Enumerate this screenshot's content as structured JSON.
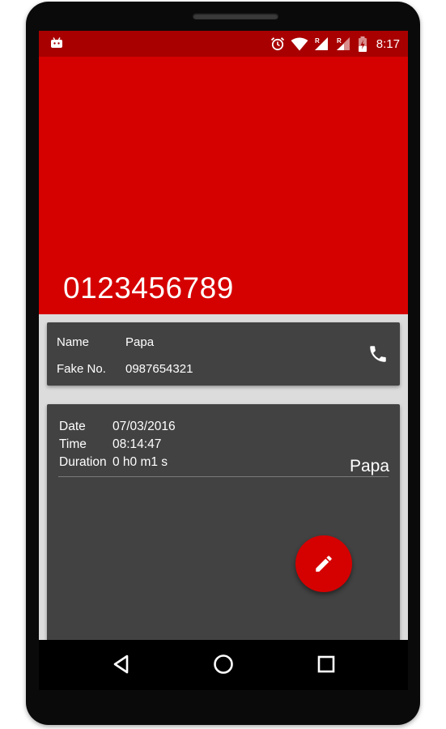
{
  "statusbar": {
    "time": "8:17",
    "icons": [
      "android-debug-icon",
      "alarm-icon",
      "wifi-icon",
      "signal-roaming-icon",
      "signal-roaming-icon",
      "battery-charging-icon"
    ]
  },
  "header": {
    "phone_number": "0123456789"
  },
  "contact_card": {
    "name_label": "Name",
    "name_value": "Papa",
    "fake_label": "Fake No.",
    "fake_value": "0987654321",
    "call_icon": "phone-icon"
  },
  "call_log": {
    "date_label": "Date",
    "date_value": "07/03/2016",
    "time_label": "Time",
    "time_value": "08:14:47",
    "duration_label": "Duration",
    "duration_value": "0 h0 m1 s",
    "caller_name": "Papa"
  },
  "fab": {
    "icon": "pencil-edit-icon"
  },
  "navbar": {
    "icons": [
      "back-icon",
      "home-icon",
      "recents-icon"
    ]
  },
  "colors": {
    "header_red": "#d50000",
    "statusbar_red": "#a80000",
    "card_bg": "#424242",
    "screen_bg": "#dcdcdc"
  }
}
